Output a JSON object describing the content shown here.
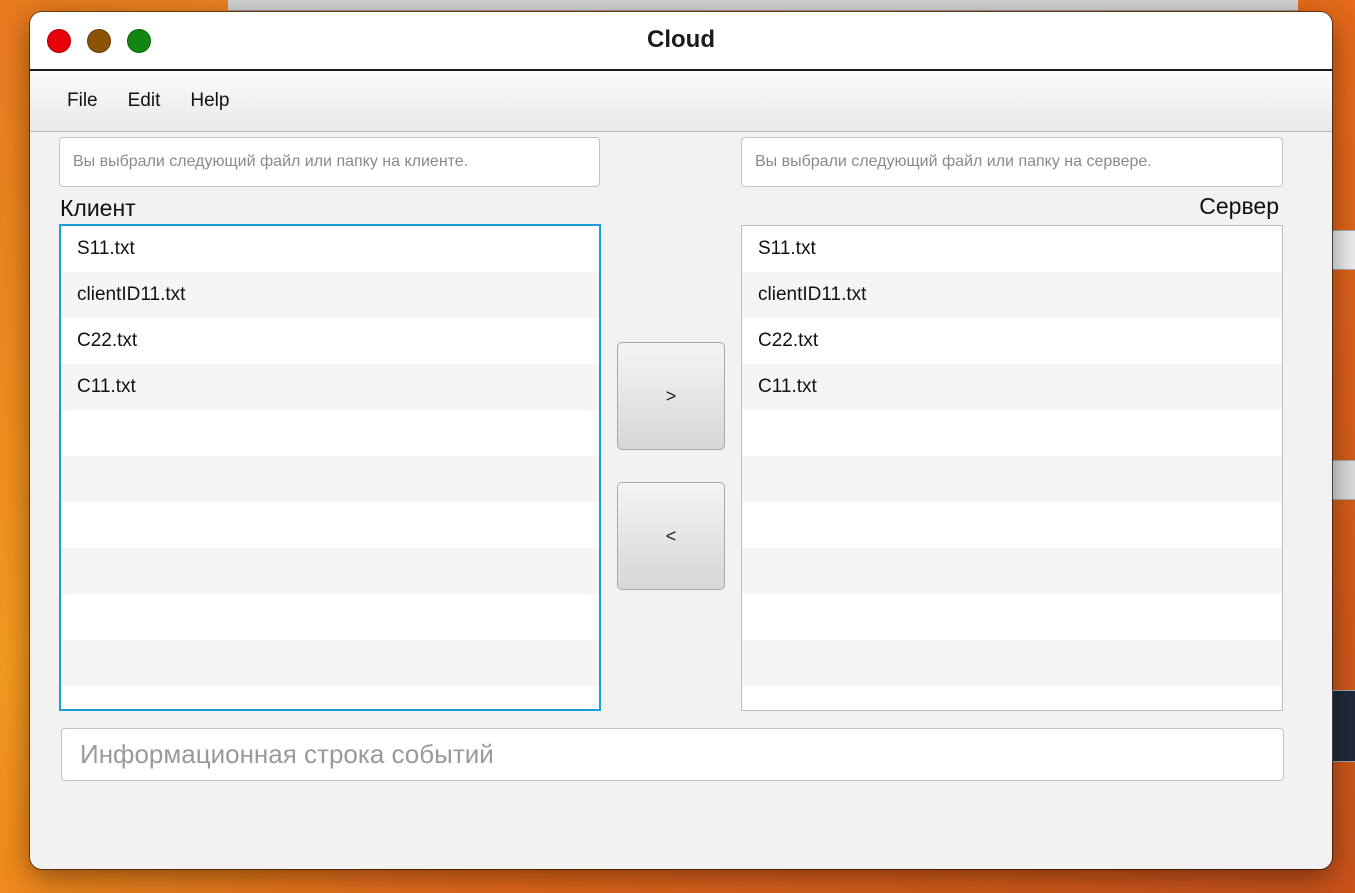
{
  "window": {
    "title": "Cloud"
  },
  "menu": {
    "items": [
      "File",
      "Edit",
      "Help"
    ]
  },
  "client": {
    "label": "Клиент",
    "path_placeholder": "Вы выбрали следующий файл или папку на клиенте.",
    "files": [
      "S11.txt",
      "clientID11.txt",
      "C22.txt",
      "C11.txt",
      "",
      "",
      "",
      "",
      "",
      "",
      ""
    ]
  },
  "server": {
    "label": "Сервер",
    "path_placeholder": "Вы выбрали следующий файл или папку на сервере.",
    "files": [
      "S11.txt",
      "clientID11.txt",
      "C22.txt",
      "C11.txt",
      "",
      "",
      "",
      "",
      "",
      "",
      ""
    ]
  },
  "actions": {
    "upload_label": ">",
    "download_label": "<"
  },
  "status": {
    "placeholder": "Информационная строка событий"
  },
  "colors": {
    "close": "#e8000b",
    "minimize": "#8b5306",
    "maximize": "#118611",
    "focus_border": "#1a9fd8"
  }
}
